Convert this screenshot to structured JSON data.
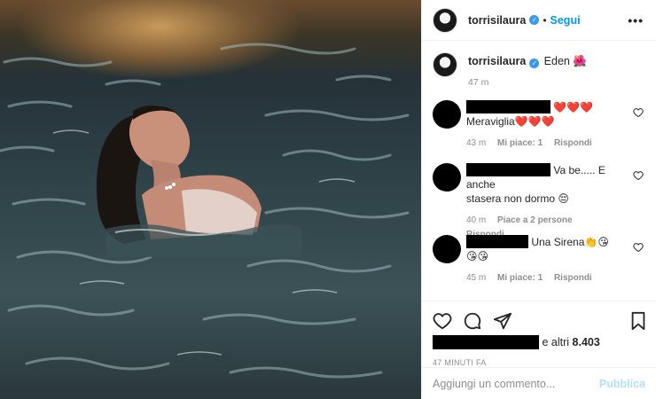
{
  "post": {
    "username": "torrisilaura",
    "verified_icon": "verified-badge-icon",
    "dot": "•",
    "follow_label": "Segui",
    "more_label": "•••"
  },
  "caption": {
    "username": "torrisilaura",
    "text": "Eden 🌺",
    "time": "47 m"
  },
  "comments": [
    {
      "author": "[redacted]",
      "text": "❤️❤️❤️",
      "text2": "Meraviglia❤️❤️❤️",
      "time": "43 m",
      "likes": "Mi piace: 1",
      "reply": "Rispondi"
    },
    {
      "author": "[redacted]",
      "text": "Va be..... E anche",
      "text2": "stasera non dormo 😔",
      "time": "40 m",
      "likes": "Piace a 2 persone",
      "reply": "Rispondi"
    },
    {
      "author": "[redacted]",
      "text": "Una Sirena👏😘",
      "text2": "😘😘",
      "time": "45 m",
      "likes": "Mi piace: 1",
      "reply": "Rispondi"
    }
  ],
  "actions": {
    "likes_text": "e altri",
    "likes_count": "8.403",
    "date": "47 MINUTI FA"
  },
  "add_comment": {
    "placeholder": "Aggiungi un commento...",
    "publish_label": "Pubblica"
  },
  "colors": {
    "accent": "#0095f6",
    "publish_disabled": "#b2dffc",
    "muted": "#8e8e8e"
  }
}
